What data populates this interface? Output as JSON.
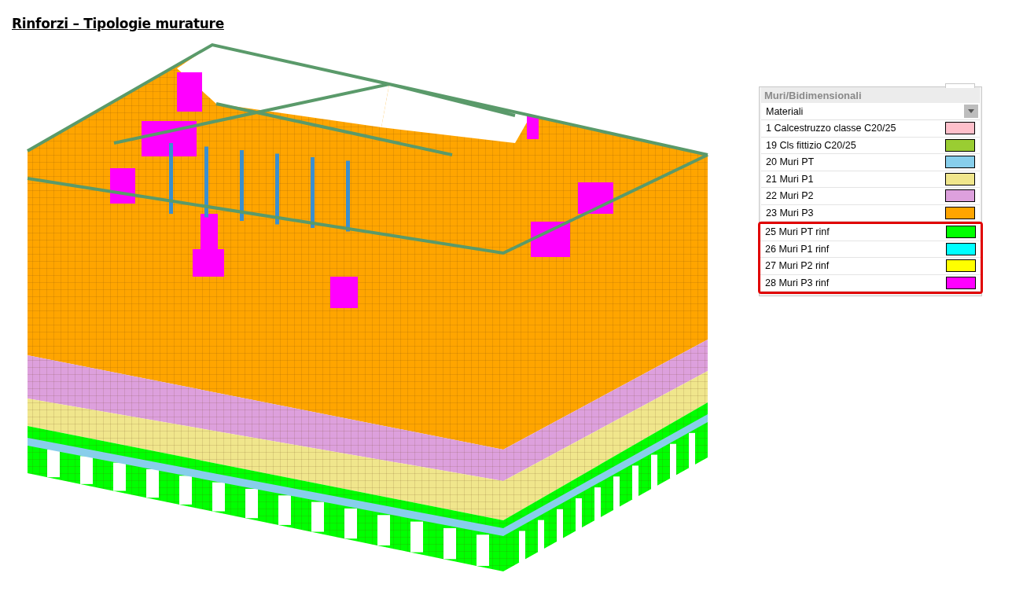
{
  "title": "Rinforzi – Tipologie murature",
  "legend": {
    "header": "Muri/Bidimensionali",
    "dropdown": {
      "value": "Materiali"
    },
    "items": [
      {
        "label": "1 Calcestruzzo classe C20/25",
        "color": "#ffc0cb",
        "highlighted": false
      },
      {
        "label": "19 Cls fittizio C20/25",
        "color": "#9acd32",
        "highlighted": false
      },
      {
        "label": "20 Muri PT",
        "color": "#87ceeb",
        "highlighted": false
      },
      {
        "label": "21 Muri P1",
        "color": "#f0e68c",
        "highlighted": false
      },
      {
        "label": "22 Muri P2",
        "color": "#dda0dd",
        "highlighted": false
      },
      {
        "label": "23 Muri P3",
        "color": "#ffa500",
        "highlighted": false
      },
      {
        "label": "25 Muri PT rinf",
        "color": "#00ff00",
        "highlighted": true
      },
      {
        "label": "26 Muri P1 rinf",
        "color": "#00ffff",
        "highlighted": true
      },
      {
        "label": "27 Muri P2 rinf",
        "color": "#ffff00",
        "highlighted": true
      },
      {
        "label": "28 Muri P3 rinf",
        "color": "#ff00ff",
        "highlighted": true
      }
    ]
  }
}
